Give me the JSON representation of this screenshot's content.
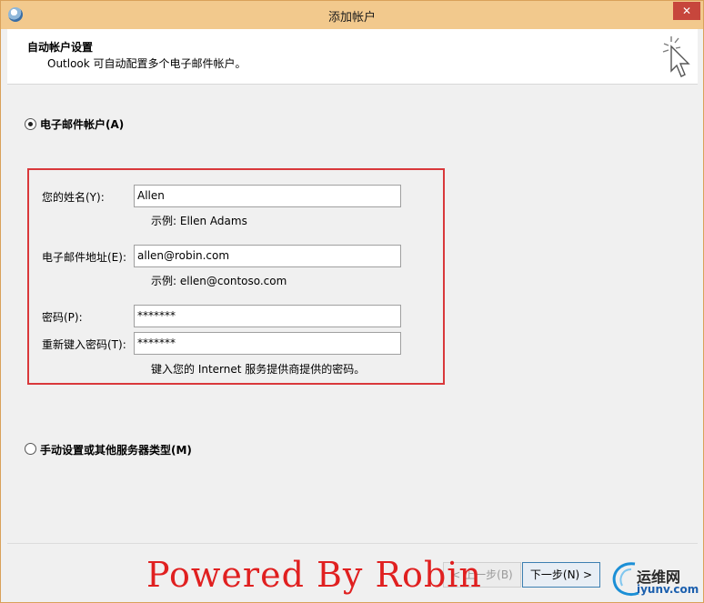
{
  "window": {
    "title": "添加帐户",
    "close_glyph": "✕"
  },
  "header": {
    "title": "自动帐户设置",
    "subtitle": "Outlook 可自动配置多个电子邮件帐户。",
    "icon": "magic-wand-cursor-icon"
  },
  "email_option": {
    "label": "电子邮件帐户(A)",
    "checked": true
  },
  "form": {
    "name": {
      "label": "您的姓名(Y):",
      "value": "Allen",
      "hint": "示例: Ellen Adams"
    },
    "email": {
      "label": "电子邮件地址(E):",
      "value": "allen@robin.com",
      "hint": "示例: ellen@contoso.com"
    },
    "password": {
      "label": "密码(P):",
      "value": "*******"
    },
    "retype_password": {
      "label": "重新键入密码(T):",
      "value": "*******",
      "hint": "键入您的 Internet 服务提供商提供的密码。"
    }
  },
  "manual_option": {
    "label": "手动设置或其他服务器类型(M)",
    "checked": false
  },
  "footer": {
    "back_label": "< 上一步(B)",
    "next_label": "下一步(N) >"
  },
  "watermark": {
    "text": "Powered By Robin"
  },
  "site_badge": {
    "top_text": "运维网",
    "bottom_text": "iyunv.com"
  },
  "colors": {
    "title_bar": "#f2c98d",
    "close_button": "#c7463c",
    "highlight_border": "#d9383b",
    "watermark": "#e02020"
  }
}
